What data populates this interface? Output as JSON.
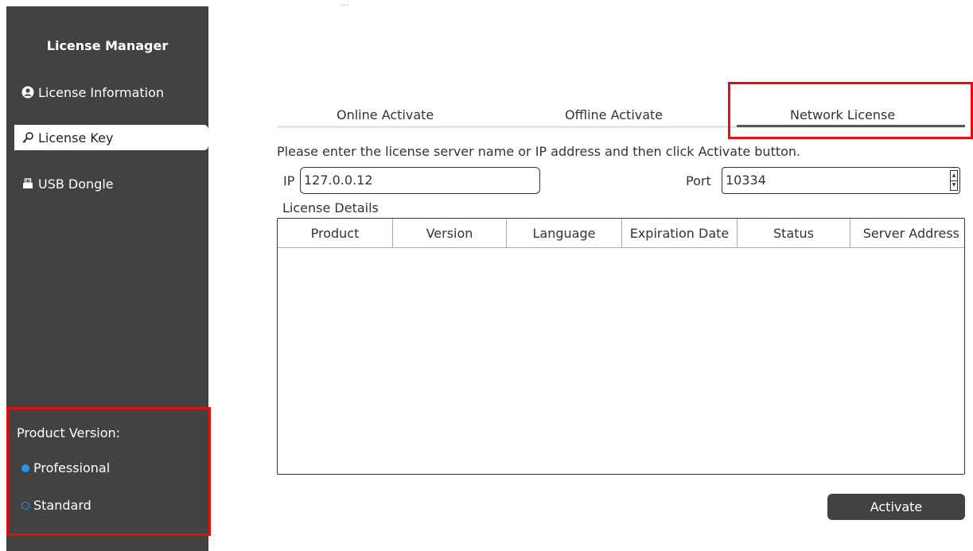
{
  "sidebar": {
    "title": "License Manager",
    "items": [
      {
        "label": "License Information",
        "icon": "user-circle-icon"
      },
      {
        "label": "License Key",
        "icon": "key-icon"
      },
      {
        "label": "USB Dongle",
        "icon": "usb-drive-icon"
      }
    ],
    "product_version": {
      "label": "Product Version:",
      "options": [
        {
          "label": "Professional",
          "selected": true
        },
        {
          "label": "Standard",
          "selected": false
        }
      ]
    }
  },
  "top_marker": "...",
  "tabs": [
    {
      "label": "Online Activate"
    },
    {
      "label": "Offline Activate"
    },
    {
      "label": "Network License"
    }
  ],
  "active_tab": "Network License",
  "instruction": "Please enter the license server name or IP address and then click Activate button.",
  "ip": {
    "label": "IP",
    "value": "127.0.0.12"
  },
  "port": {
    "label": "Port",
    "value": "10334"
  },
  "details": {
    "label": "License Details",
    "columns": [
      "Product",
      "Version",
      "Language",
      "Expiration Date",
      "Status",
      "Server Address"
    ],
    "rows": []
  },
  "activate_label": "Activate",
  "colors": {
    "sidebar_bg": "#424242",
    "highlight": "#e01010",
    "radio_accent": "#2196f3"
  }
}
